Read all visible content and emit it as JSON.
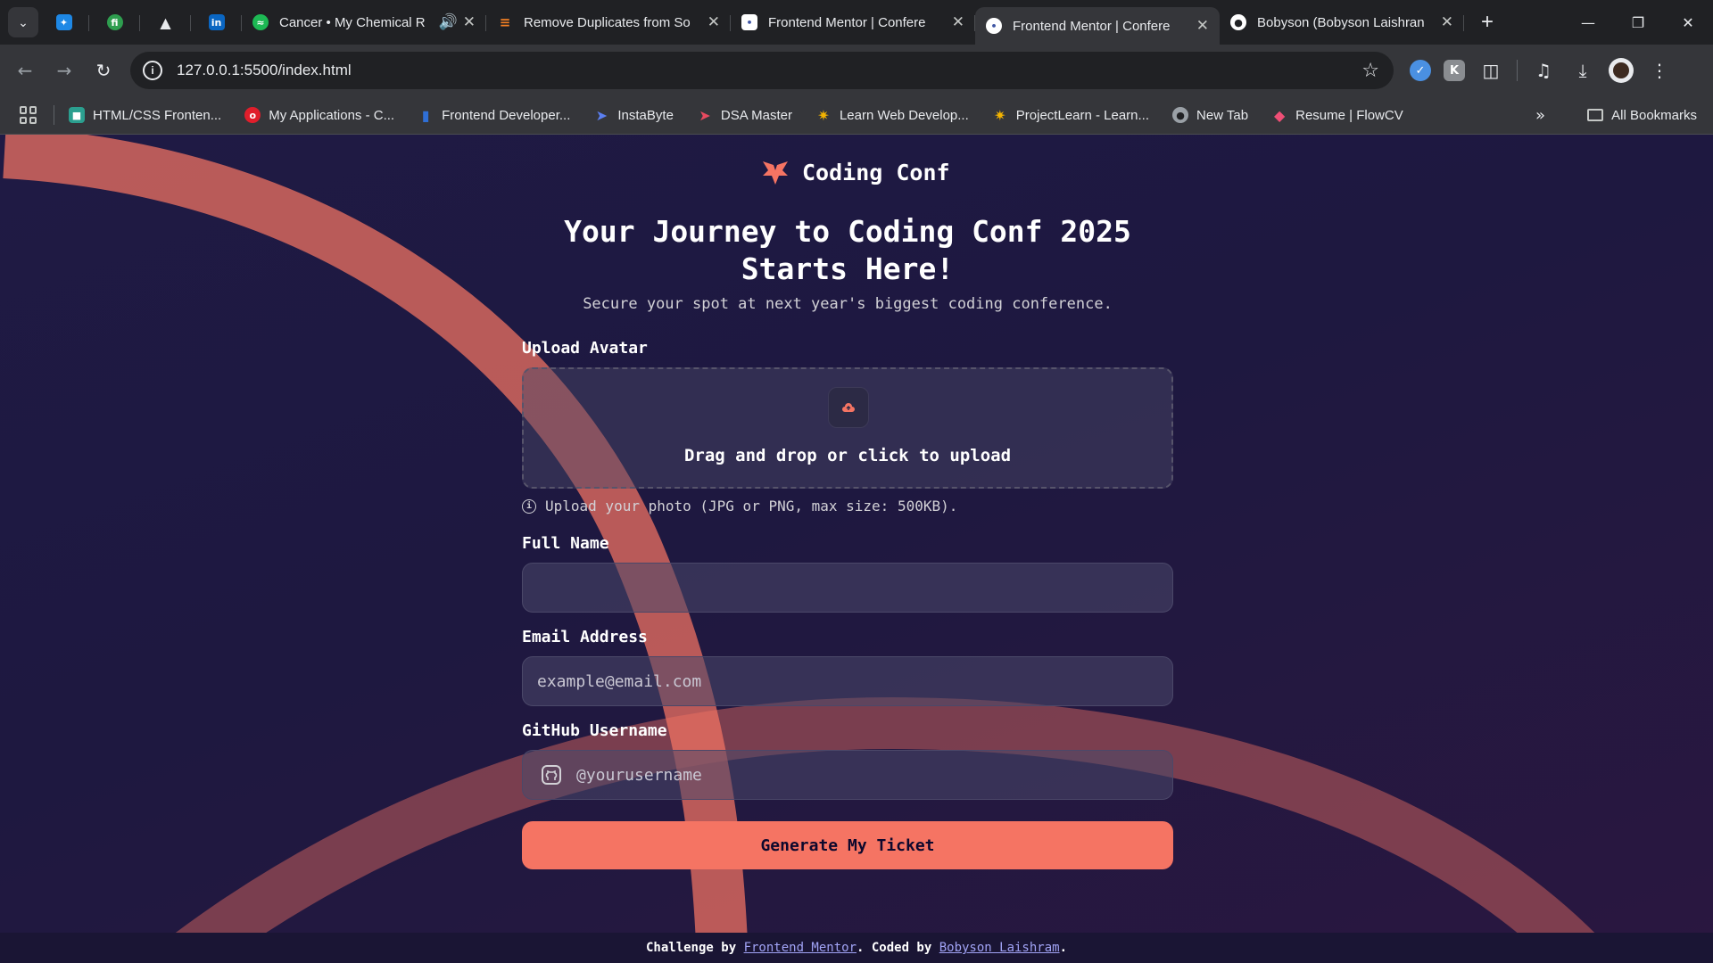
{
  "browser": {
    "tabs": [
      {
        "title": "Cancer • My Chemical R",
        "favicon": "spotify-icon",
        "color": "#1db954",
        "audio": true
      },
      {
        "title": "Remove Duplicates from So",
        "favicon": "stackoverflow-icon",
        "color": "#f48024"
      },
      {
        "title": "Frontend Mentor | Confere",
        "favicon": "frontend-mentor-icon",
        "color": "#ffffff"
      },
      {
        "title": "Frontend Mentor | Confere",
        "favicon": "frontend-mentor-icon",
        "color": "#ffffff",
        "active": true
      },
      {
        "title": "Bobyson (Bobyson Laishran",
        "favicon": "github-icon",
        "color": "#ffffff"
      }
    ],
    "pinned_tabs": [
      "bird-icon",
      "frontend-hub-icon",
      "flask-icon",
      "linkedin-icon"
    ],
    "url": "127.0.0.1:5500/index.html",
    "bookmarks": [
      {
        "label": "HTML/CSS Fronten...",
        "color": "#2b9f8f"
      },
      {
        "label": "My Applications - C...",
        "color": "#e01e2b"
      },
      {
        "label": "Frontend Developer...",
        "color": "#2f6fd6"
      },
      {
        "label": "InstaByte",
        "color": "#5b7ff0"
      },
      {
        "label": "DSA Master",
        "color": "#e84a5f"
      },
      {
        "label": "Learn Web Develop...",
        "color": "#f4b400"
      },
      {
        "label": "ProjectLearn - Learn...",
        "color": "#f4b400"
      },
      {
        "label": "New Tab",
        "color": "#9aa0a6"
      },
      {
        "label": "Resume | FlowCV",
        "color": "#ef4f76"
      }
    ],
    "all_bookmarks": "All Bookmarks"
  },
  "page": {
    "logo_text": "Coding Conf",
    "headline_line1": "Your Journey to Coding Conf 2025",
    "headline_line2": "Starts Here!",
    "subheadline": "Secure your spot at next year's biggest coding conference.",
    "upload_label": "Upload Avatar",
    "upload_text": "Drag and drop or click to upload",
    "upload_hint": "Upload your photo (JPG or PNG, max size: 500KB).",
    "full_name_label": "Full Name",
    "full_name_value": "",
    "email_label": "Email Address",
    "email_placeholder": "example@email.com",
    "github_label": "GitHub Username",
    "github_placeholder": "@yourusername",
    "submit_label": "Generate My Ticket",
    "footer": {
      "prefix": "Challenge by ",
      "link1": "Frontend Mentor",
      "middle": ". Coded by ",
      "link2": "Bobyson Laishram",
      "suffix": "."
    },
    "colors": {
      "accent": "#f57463",
      "background": "#1e1840",
      "link": "#a1a3f5"
    }
  }
}
